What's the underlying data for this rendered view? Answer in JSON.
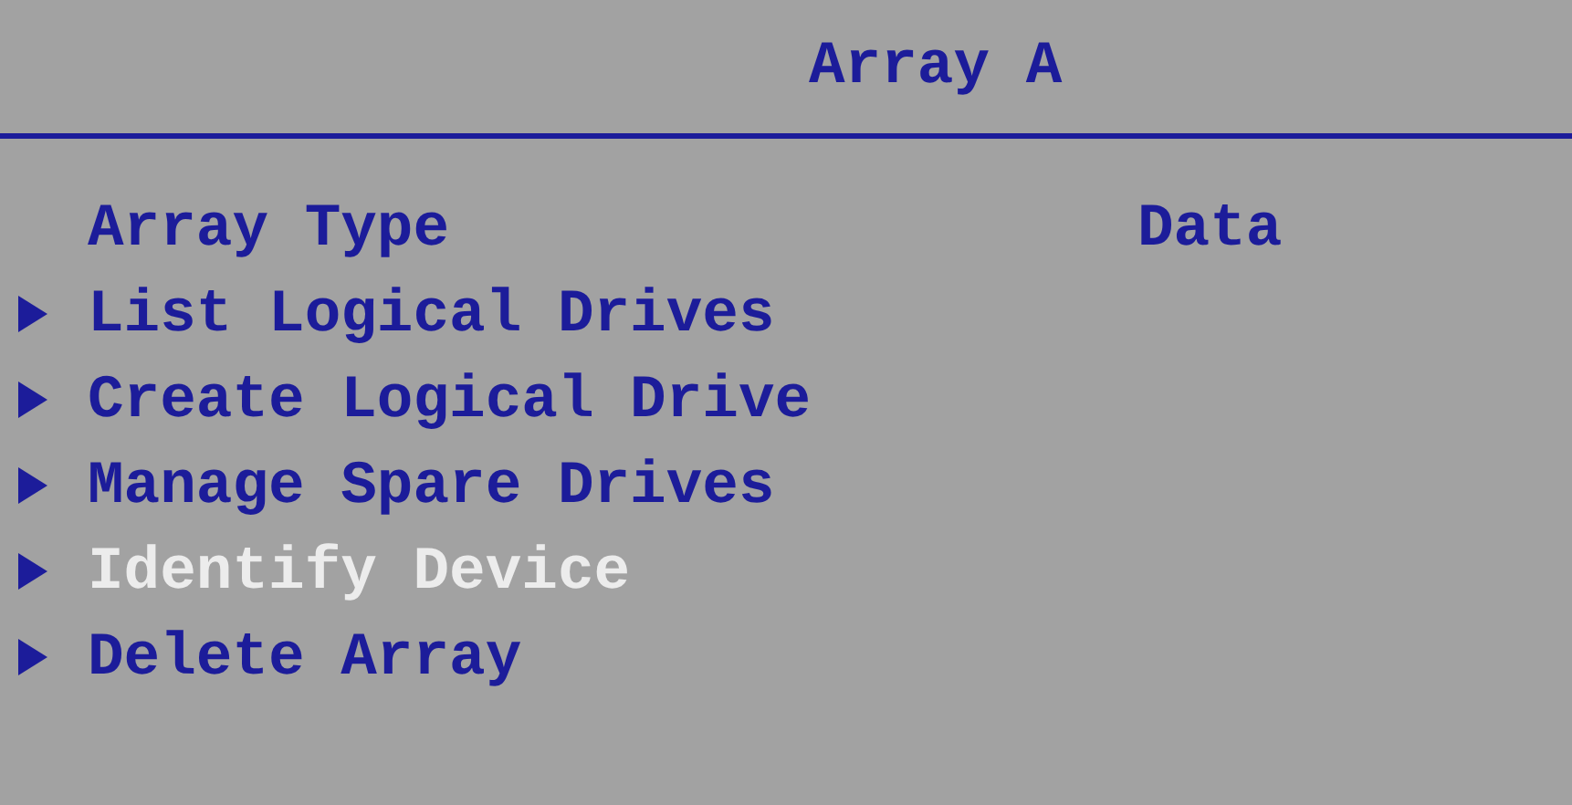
{
  "title": "Array A",
  "items": [
    {
      "kind": "field",
      "label": "Array Type",
      "value": "Data",
      "selected": false
    },
    {
      "kind": "submenu",
      "label": "List Logical Drives",
      "selected": false
    },
    {
      "kind": "submenu",
      "label": "Create Logical Drive",
      "selected": false
    },
    {
      "kind": "submenu",
      "label": "Manage Spare Drives",
      "selected": false
    },
    {
      "kind": "submenu",
      "label": "Identify Device",
      "selected": true
    },
    {
      "kind": "submenu",
      "label": "Delete Array",
      "selected": false
    }
  ]
}
